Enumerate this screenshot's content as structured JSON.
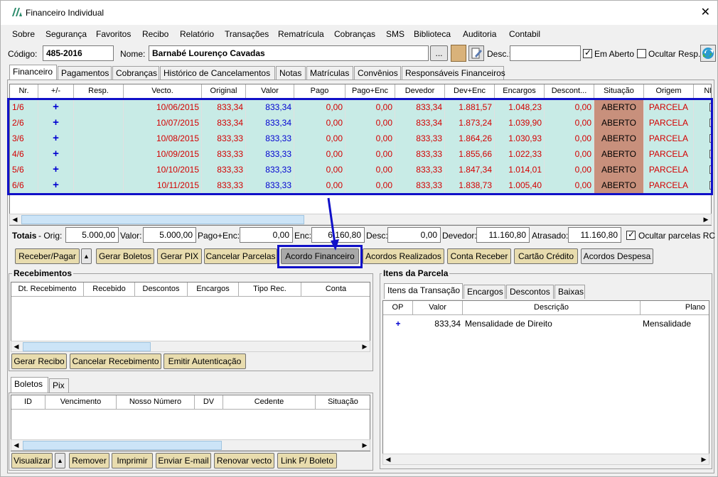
{
  "window": {
    "title": "Financeiro Individual",
    "close": "✕"
  },
  "menu": [
    "Sobre",
    "Segurança",
    "Favoritos",
    "Recibo",
    "Relatório",
    "Transações",
    "Rematrícula",
    "Cobranças",
    "SMS",
    "Biblioteca",
    "Auditoria",
    "Contabil"
  ],
  "header": {
    "codigo_label": "Código:",
    "codigo_value": "485-2016",
    "nome_label": "Nome:",
    "nome_value": "Barnabé Lourenço Cavadas",
    "ellipsis": "...",
    "desc_label": "Desc.:",
    "desc_value": "",
    "em_aberto": "Em Aberto",
    "ocultar_resp": "Ocultar Resp."
  },
  "tabs": [
    "Financeiro",
    "Pagamentos",
    "Cobranças",
    "Histórico de Cancelamentos",
    "Notas",
    "Matrículas",
    "Convênios",
    "Responsáveis Financeiros"
  ],
  "parcelas": {
    "columns": [
      "Nr.",
      "+/-",
      "Resp.",
      "Vecto.",
      "Original",
      "Valor",
      "Pago",
      "Pago+Enc",
      "Devedor",
      "Dev+Enc",
      "Encargos",
      "Descont...",
      "Situação",
      "Origem",
      "NF"
    ],
    "rows": [
      {
        "nr": "1/6",
        "pm": "+",
        "resp": "",
        "vecto": "10/06/2015",
        "original": "833,34",
        "valor": "833,34",
        "pago": "0,00",
        "pagoenc": "0,00",
        "devedor": "833,34",
        "devenc": "1.881,57",
        "encargos": "1.048,23",
        "desc": "0,00",
        "situacao": "ABERTO",
        "origem": "PARCELA"
      },
      {
        "nr": "2/6",
        "pm": "+",
        "resp": "",
        "vecto": "10/07/2015",
        "original": "833,34",
        "valor": "833,34",
        "pago": "0,00",
        "pagoenc": "0,00",
        "devedor": "833,34",
        "devenc": "1.873,24",
        "encargos": "1.039,90",
        "desc": "0,00",
        "situacao": "ABERTO",
        "origem": "PARCELA"
      },
      {
        "nr": "3/6",
        "pm": "+",
        "resp": "",
        "vecto": "10/08/2015",
        "original": "833,33",
        "valor": "833,33",
        "pago": "0,00",
        "pagoenc": "0,00",
        "devedor": "833,33",
        "devenc": "1.864,26",
        "encargos": "1.030,93",
        "desc": "0,00",
        "situacao": "ABERTO",
        "origem": "PARCELA"
      },
      {
        "nr": "4/6",
        "pm": "+",
        "resp": "",
        "vecto": "10/09/2015",
        "original": "833,33",
        "valor": "833,33",
        "pago": "0,00",
        "pagoenc": "0,00",
        "devedor": "833,33",
        "devenc": "1.855,66",
        "encargos": "1.022,33",
        "desc": "0,00",
        "situacao": "ABERTO",
        "origem": "PARCELA"
      },
      {
        "nr": "5/6",
        "pm": "+",
        "resp": "",
        "vecto": "10/10/2015",
        "original": "833,33",
        "valor": "833,33",
        "pago": "0,00",
        "pagoenc": "0,00",
        "devedor": "833,33",
        "devenc": "1.847,34",
        "encargos": "1.014,01",
        "desc": "0,00",
        "situacao": "ABERTO",
        "origem": "PARCELA"
      },
      {
        "nr": "6/6",
        "pm": "+",
        "resp": "",
        "vecto": "10/11/2015",
        "original": "833,33",
        "valor": "833,33",
        "pago": "0,00",
        "pagoenc": "0,00",
        "devedor": "833,33",
        "devenc": "1.838,73",
        "encargos": "1.005,40",
        "desc": "0,00",
        "situacao": "ABERTO",
        "origem": "PARCELA"
      }
    ]
  },
  "totais": {
    "label": "Totais",
    "orig_label": "- Orig:",
    "orig": "5.000,00",
    "valor_label": "Valor:",
    "valor": "5.000,00",
    "pagoenc_label": "Pago+Enc:",
    "pagoenc": "0,00",
    "enc_label": "Enc:",
    "enc": "6.160,80",
    "desc_label": "Desc:",
    "desc": "0,00",
    "devedor_label": "Devedor:",
    "devedor": "11.160,80",
    "atrasado_label": "Atrasado:",
    "atrasado": "11.160,80",
    "ocultar": "Ocultar parcelas RC"
  },
  "actions": [
    "Receber/Pagar",
    "Gerar Boletos",
    "Gerar PIX",
    "Cancelar Parcelas",
    "Acordo Financeiro",
    "Acordos Realizados",
    "Conta Receber",
    "Cartão Crédito",
    "Acordos Despesa"
  ],
  "recebimentos": {
    "title": "Recebimentos",
    "columns": [
      "Dt. Recebimento",
      "Recebido",
      "Descontos",
      "Encargos",
      "Tipo Rec.",
      "Conta"
    ],
    "buttons": [
      "Gerar Recibo",
      "Cancelar Recebimento",
      "Emitir Autenticação"
    ]
  },
  "itens": {
    "title": "Itens da Parcela",
    "tabs": [
      "Itens da Transação",
      "Encargos",
      "Descontos",
      "Baixas"
    ],
    "columns": [
      "OP",
      "Valor",
      "Descrição",
      "Plano"
    ],
    "rows": [
      {
        "op": "+",
        "valor": "833,34",
        "descricao": "Mensalidade de Direito",
        "plano": "Mensalidade"
      }
    ]
  },
  "boletos": {
    "tabs": [
      "Boletos",
      "Pix"
    ],
    "columns": [
      "ID",
      "Vencimento",
      "Nosso Número",
      "DV",
      "Cedente",
      "Situação"
    ],
    "buttons": [
      "Visualizar",
      "Remover",
      "Imprimir",
      "Enviar E-mail",
      "Renovar vecto",
      "Link P/ Boleto"
    ]
  },
  "colors": {
    "row_bg": "#c8ebe6",
    "text_red": "#d40000",
    "text_blue": "#0000d0",
    "situacao_bg": "#c8907c",
    "button_bg": "#e8dcae",
    "highlight": "#1010c8"
  }
}
